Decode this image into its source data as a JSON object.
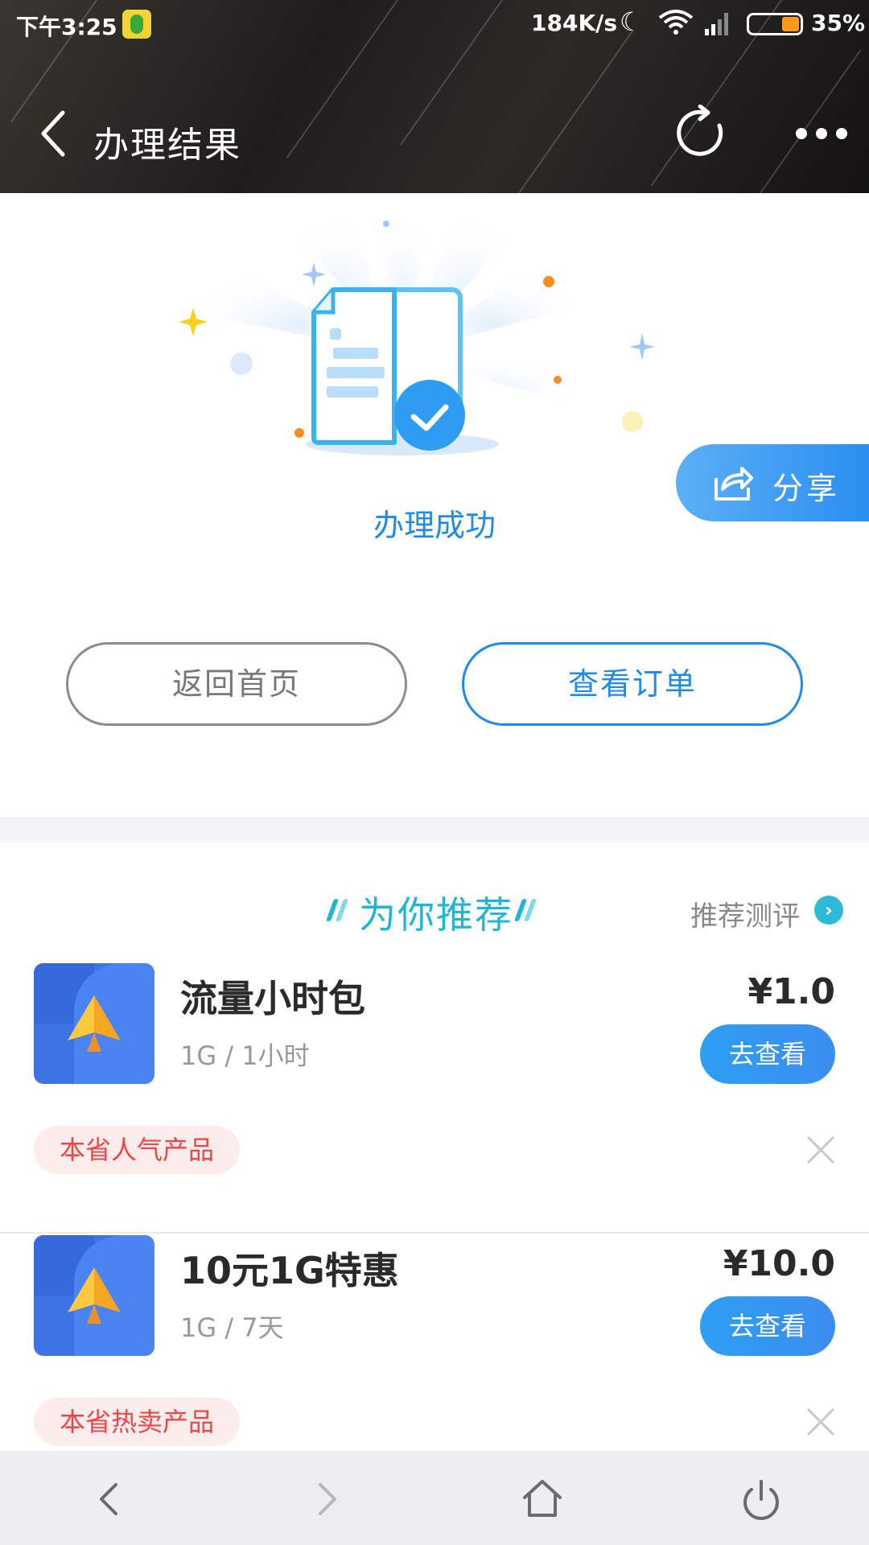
{
  "status_bar": {
    "time": "下午3:25",
    "speed": "184K/s",
    "battery_pct": "35%",
    "battery_level": 0.35
  },
  "nav": {
    "title": "办理结果"
  },
  "result": {
    "status_text": "办理成功",
    "share_label": "分享",
    "home_button": "返回首页",
    "order_button": "查看订单"
  },
  "recommend": {
    "title": "为你推荐",
    "review_link": "推荐测评",
    "products": [
      {
        "name": "流量小时包",
        "spec": "1G / 1小时",
        "price": "¥1.0",
        "button": "去查看",
        "tag": "本省人气产品"
      },
      {
        "name": "10元1G特惠",
        "spec": "1G / 7天",
        "price": "¥10.0",
        "button": "去查看",
        "tag": "本省热卖产品"
      }
    ]
  },
  "colors": {
    "accent": "#1f8be6",
    "teal": "#1fb6d4",
    "tag_red": "#ee4646"
  }
}
